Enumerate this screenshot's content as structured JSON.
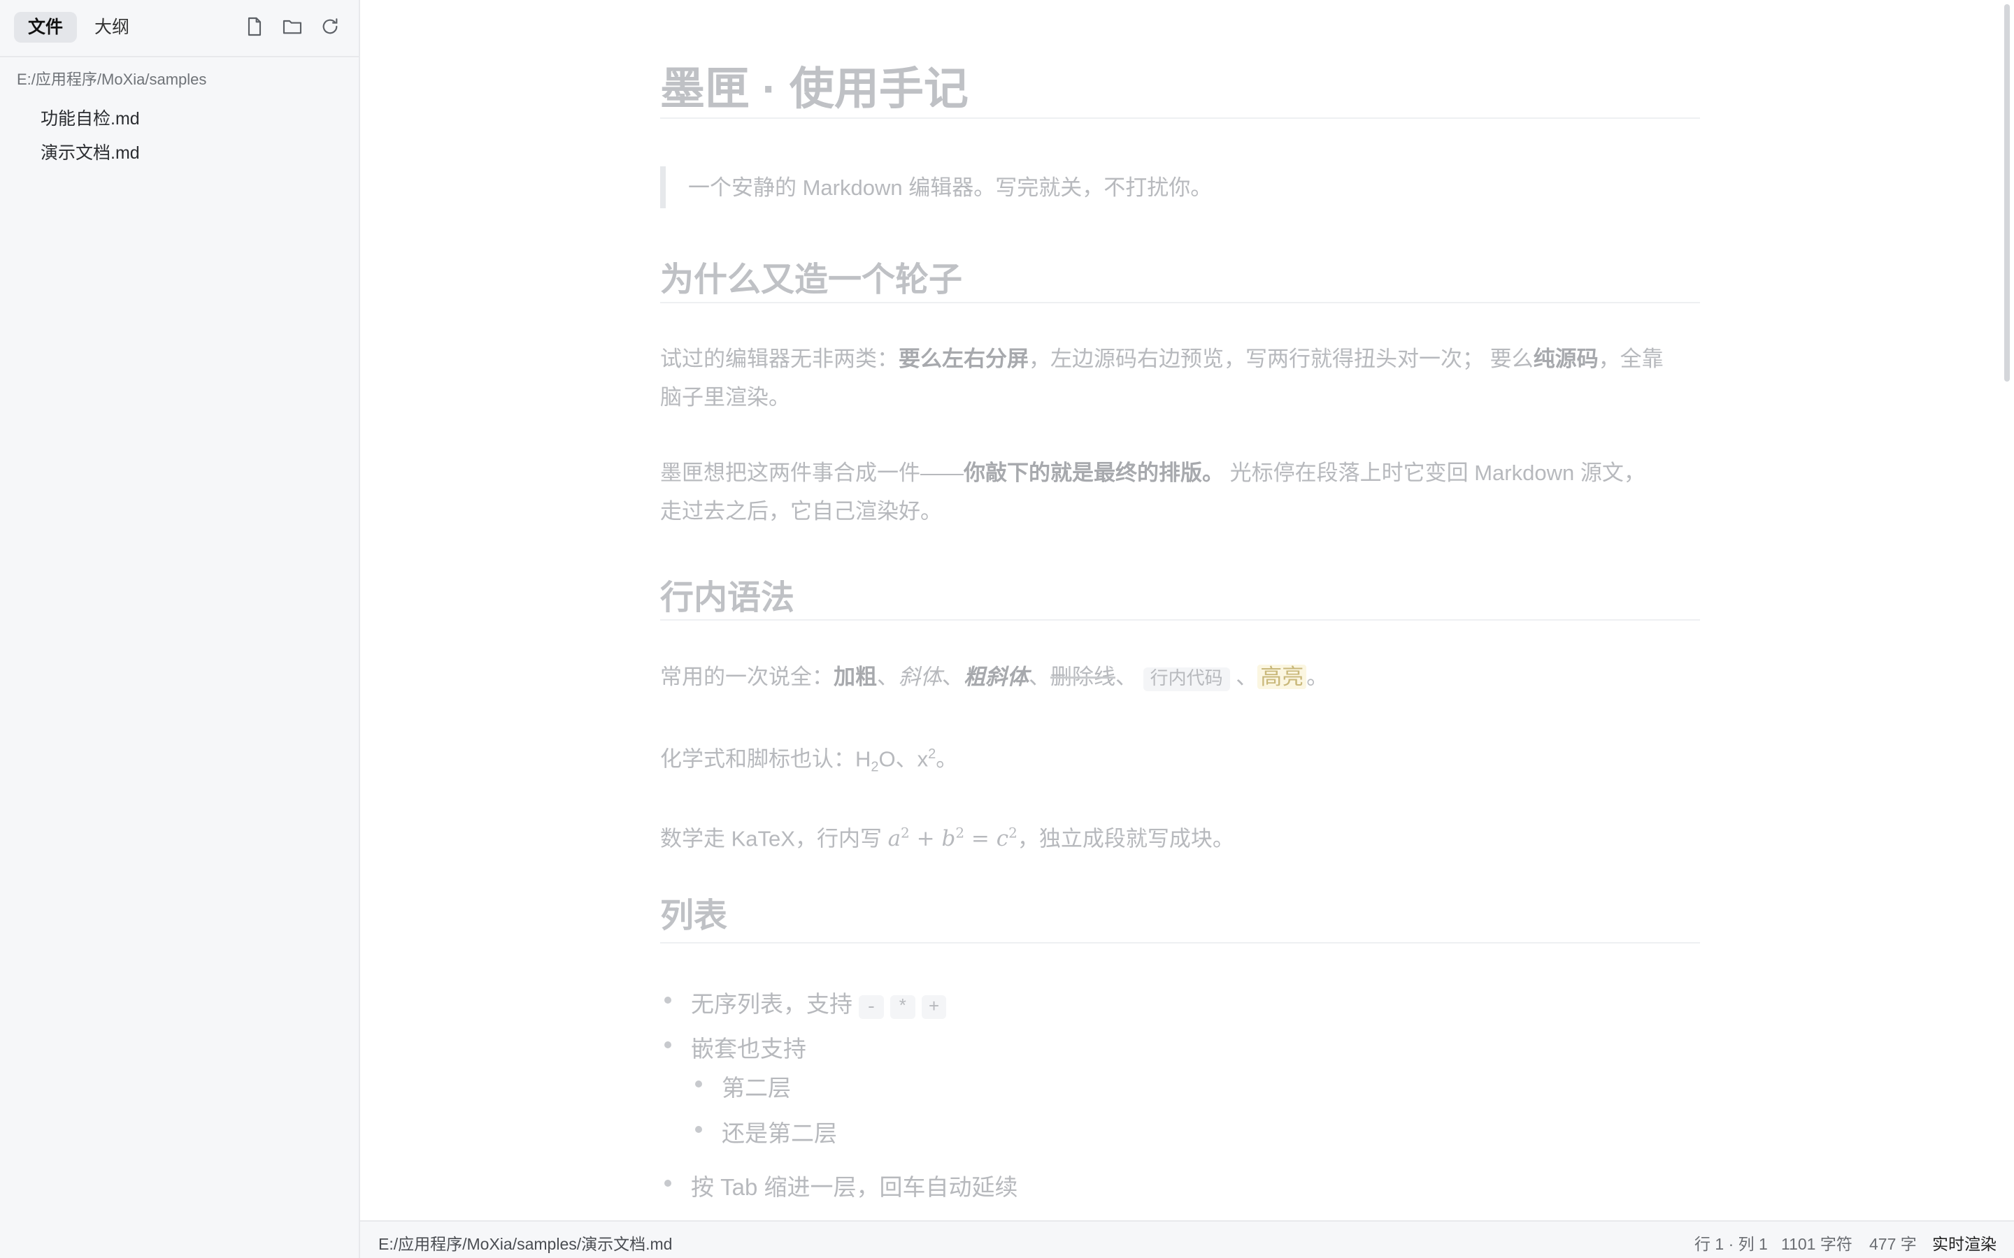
{
  "sidebar": {
    "tabs": [
      {
        "label": "文件",
        "active": true
      },
      {
        "label": "大纲",
        "active": false
      }
    ],
    "icons": [
      "new-file-icon",
      "open-folder-icon",
      "refresh-icon"
    ],
    "path": "E:/应用程序/MoXia/samples",
    "files": [
      {
        "name": "功能自检.md"
      },
      {
        "name": "演示文档.md"
      }
    ]
  },
  "doc": {
    "title": "墨匣 · 使用手记",
    "quote": "一个安静的 Markdown 编辑器。写完就关，不打扰你。",
    "h2_why": "为什么又造一个轮子",
    "why_p1": {
      "t1": "试过的编辑器无非两类：",
      "b1": "要么左右分屏",
      "t2": "，左边源码右边预览，写两行就得扭头对一次； 要么",
      "b2": "纯源码",
      "t3": "，全靠",
      "line2": "脑子里渲染。"
    },
    "why_p2": {
      "t1": "墨匣想把这两件事合成一件——",
      "b1": "你敲下的就是最终的排版。",
      "t2": " 光标停在段落上时它变回 Markdown 源文，",
      "line2": "走过去之后，它自己渲染好。"
    },
    "h2_inline": "行内语法",
    "inline_p": {
      "t1": "常用的一次说全：",
      "bold": "加粗",
      "sep": "、",
      "italic": "斜体",
      "bolditalic": "粗斜体",
      "strike": "删除线",
      "code": "行内代码",
      "highlight": "高亮",
      "end": "。"
    },
    "chem_p": {
      "t1": "化学式和脚标也认：",
      "h": "H",
      "sub": "2",
      "o": "O",
      "x": "x",
      "sup": "2",
      "end": "。"
    },
    "math_p": {
      "t1": "数学走 KaTeX，行内写 ",
      "a": "a",
      "plus": " + ",
      "b": "b",
      "eq": " = ",
      "c": "c",
      "exp": "2",
      "t2": "，独立成段就写成块。"
    },
    "h2_list": "列表",
    "list": {
      "item1": "无序列表，支持",
      "codes": [
        "-",
        "*",
        "+"
      ],
      "item2": "嵌套也支持",
      "sub1": "第二层",
      "sub2": "还是第二层",
      "item3": "按 Tab 缩进一层，回车自动延续"
    }
  },
  "statusbar": {
    "path": "E:/应用程序/MoXia/samples/演示文档.md",
    "position": "行 1 · 列 1",
    "chars": "1101 字符",
    "words": "477 字",
    "mode": "实时渲染"
  }
}
